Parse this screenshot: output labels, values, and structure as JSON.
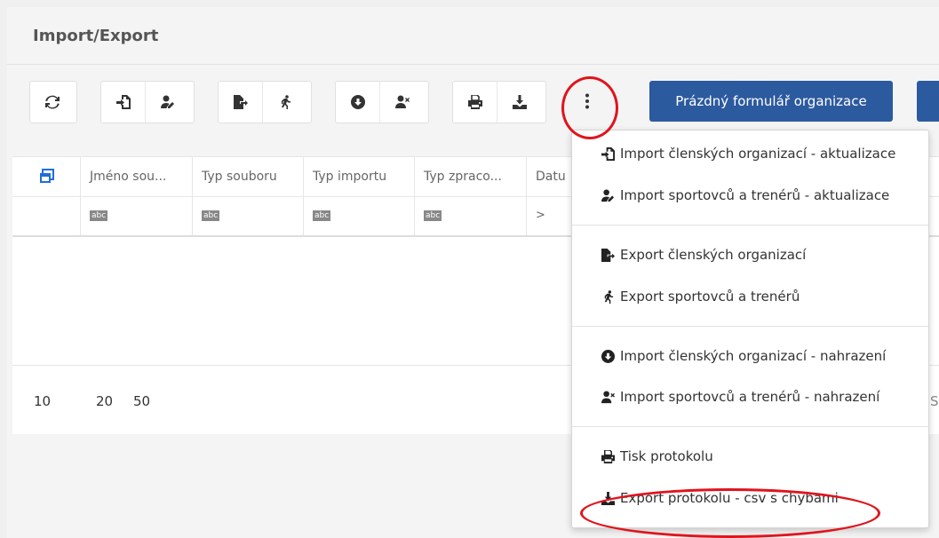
{
  "header": {
    "title": "Import/Export"
  },
  "toolbar": {
    "primary_label": "Prázdný formulář organizace"
  },
  "grid": {
    "columns": [
      "Jméno sou...",
      "Typ souboru",
      "Typ importu",
      "Typ zpraco...",
      "Datu"
    ],
    "filters": [
      "abc",
      "abc",
      "abc",
      "abc",
      ">"
    ]
  },
  "pager": {
    "sizes": [
      "10",
      "20",
      "50"
    ],
    "trailing_text": "St"
  },
  "menu": {
    "items": [
      {
        "label": "Import členských organizací - aktualizace",
        "icon": "file-import-icon"
      },
      {
        "label": "Import sportovců a trenérů - aktualizace",
        "icon": "user-edit-icon"
      },
      {
        "label": "Export členských organizací",
        "icon": "file-export-icon"
      },
      {
        "label": "Export sportovců a trenérů",
        "icon": "running-icon"
      },
      {
        "label": "Import členských organizací - nahrazení",
        "icon": "arrow-circle-down-icon"
      },
      {
        "label": "Import sportovců a trenérů - nahrazení",
        "icon": "user-times-icon"
      },
      {
        "label": "Tisk protokolu",
        "icon": "print-icon"
      },
      {
        "label": "Export protokolu - csv s chybami",
        "icon": "download-icon"
      }
    ]
  },
  "colors": {
    "primary": "#2c5a9e",
    "highlight_circle": "#e0141d",
    "grid_icon": "#1e6fd9"
  }
}
